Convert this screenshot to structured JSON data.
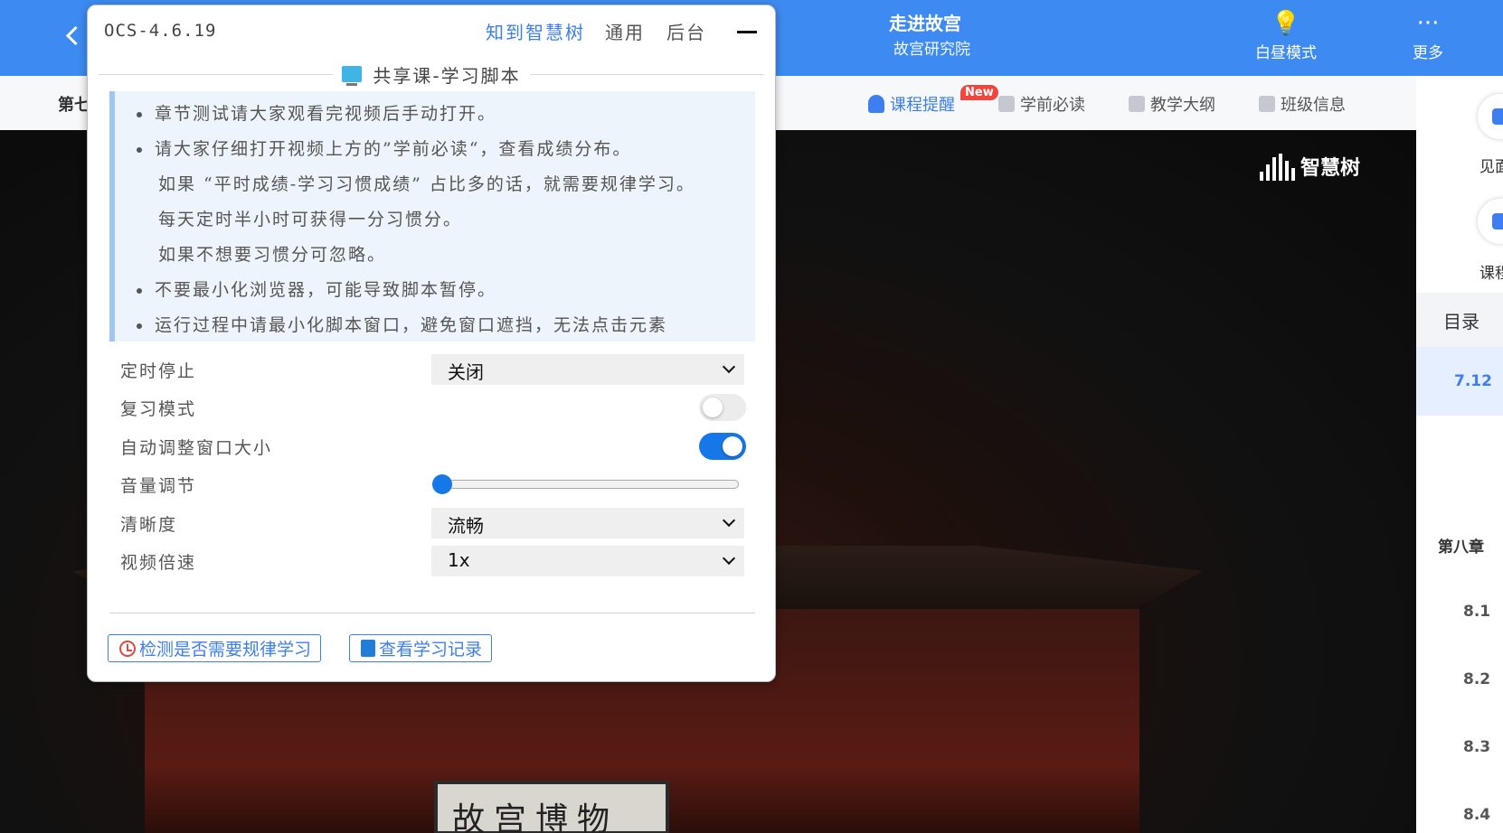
{
  "course": {
    "title": "走进故宫",
    "org": "故宫研究院",
    "actions": [
      {
        "label": "白昼模式",
        "icon": "lightbulb-icon"
      },
      {
        "label": "更多",
        "icon": "more-dots-icon"
      }
    ]
  },
  "subnav": {
    "chapter_stub": "第七",
    "badge": "New",
    "items": [
      {
        "label": "课程提醒",
        "icon": "bell-icon"
      },
      {
        "label": "学前必读",
        "icon": "notice-icon"
      },
      {
        "label": "教学大纲",
        "icon": "book-icon"
      },
      {
        "label": "班级信息",
        "icon": "list-icon"
      }
    ]
  },
  "video": {
    "watermark": "智慧树",
    "plaque": "故宫博物院"
  },
  "right_panel": {
    "buttons": [
      {
        "label": "见面"
      },
      {
        "label": "课程"
      }
    ],
    "toc_tab": "目录",
    "active_item": "7.12",
    "chapter": "第八章",
    "items": [
      "8.1",
      "8.2",
      "8.3",
      "8.4"
    ]
  },
  "panel": {
    "version": "OCS-4.6.19",
    "tabs": [
      {
        "label": "知到智慧树",
        "active": true
      },
      {
        "label": "通用",
        "active": false
      },
      {
        "label": "后台",
        "active": false
      }
    ],
    "section_title": "共享课-学习脚本",
    "section_icon": "monitor-icon",
    "notices": [
      {
        "text": "章节测试请大家观看完视频后手动打开。",
        "bullet": true
      },
      {
        "text": "请大家仔细打开视频上方的”学前必读“，查看成绩分布。",
        "bullet": true
      },
      {
        "text": "如果 “平时成绩-学习习惯成绩” 占比多的话，就需要规律学习。",
        "bullet": false
      },
      {
        "text": "每天定时半小时可获得一分习惯分。",
        "bullet": false
      },
      {
        "text": "如果不想要习惯分可忽略。",
        "bullet": false
      },
      {
        "text": "不要最小化浏览器，可能导致脚本暂停。",
        "bullet": true
      },
      {
        "text": "运行过程中请最小化脚本窗口，避免窗口遮挡，无法点击元素",
        "bullet": true
      }
    ],
    "settings": {
      "timer_stop": {
        "label": "定时停止",
        "value": "关闭"
      },
      "review_mode": {
        "label": "复习模式",
        "on": false
      },
      "auto_resize": {
        "label": "自动调整窗口大小",
        "on": true
      },
      "volume": {
        "label": "音量调节",
        "value": 0
      },
      "quality": {
        "label": "清晰度",
        "value": "流畅"
      },
      "speed": {
        "label": "视频倍速",
        "value": "1x"
      }
    },
    "buttons": {
      "check_regular": "检测是否需要规律学习",
      "view_records": "查看学习记录"
    }
  }
}
